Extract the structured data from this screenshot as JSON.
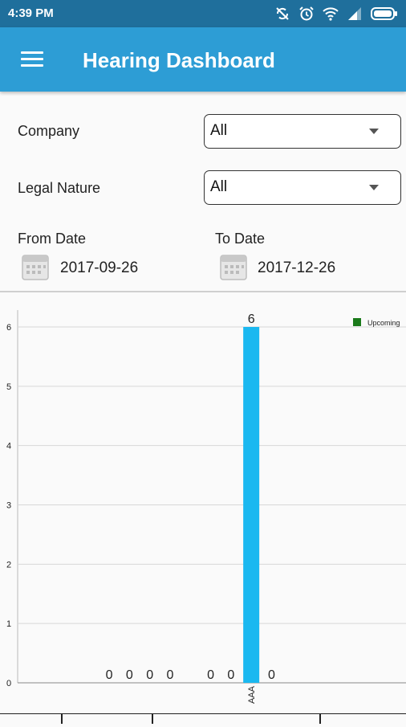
{
  "status_bar": {
    "time": "4:39 PM",
    "icons": [
      "sync-off-icon",
      "alarm-icon",
      "wifi-icon",
      "signal-icon",
      "battery-icon"
    ]
  },
  "app_bar": {
    "title": "Hearing Dashboard",
    "menu_icon": "hamburger-menu-icon",
    "color": "#2d9dd5"
  },
  "filters": {
    "company": {
      "label": "Company",
      "value": "All"
    },
    "legal_nature": {
      "label": "Legal Nature",
      "value": "All"
    }
  },
  "dates": {
    "from": {
      "label": "From Date",
      "value": "2017-09-26"
    },
    "to": {
      "label": "To Date",
      "value": "2017-12-26"
    }
  },
  "chart_data": {
    "type": "bar",
    "categories": [
      "",
      "",
      "",
      "",
      "",
      "",
      "",
      "",
      "AAA",
      ""
    ],
    "series": [
      {
        "name": "Upcoming",
        "values": [
          0,
          0,
          0,
          0,
          null,
          0,
          0,
          6,
          0
        ],
        "color": "#1ab8f0"
      }
    ],
    "bars": [
      {
        "category": "",
        "value": 0
      },
      {
        "category": "",
        "value": 0
      },
      {
        "category": "",
        "value": 0
      },
      {
        "category": "",
        "value": 0
      },
      {
        "category": "",
        "value": 0
      },
      {
        "category": "",
        "value": 0
      },
      {
        "category": "AAA",
        "value": 6
      },
      {
        "category": "",
        "value": 0
      }
    ],
    "y_ticks": [
      "0",
      "1",
      "2",
      "3",
      "4",
      "5",
      "6"
    ],
    "ylim": [
      0,
      6
    ],
    "grid": true,
    "legend": {
      "label": "Upcoming",
      "color": "#1a7a1a",
      "placement": "top-right"
    },
    "bar_color": "#1ab8f0"
  }
}
